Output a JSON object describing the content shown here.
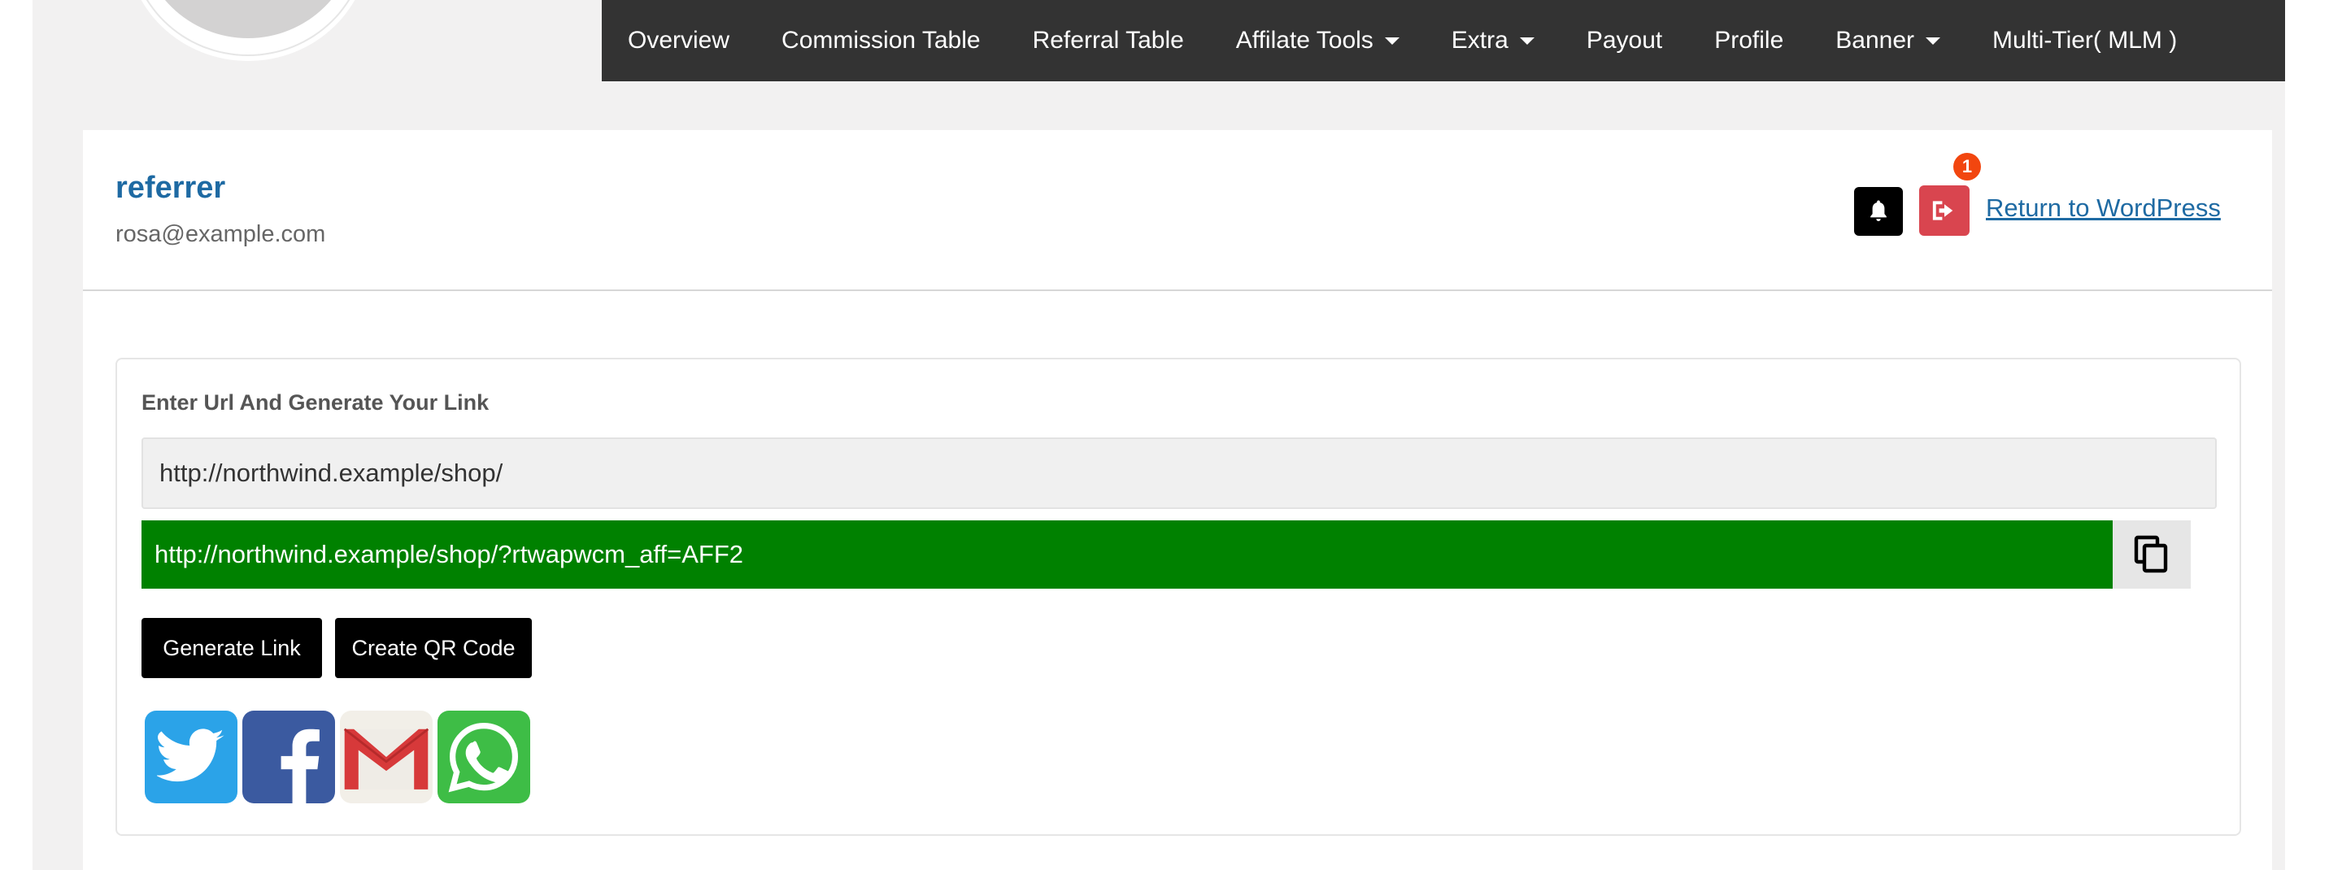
{
  "nav": {
    "items": [
      {
        "label": "Overview",
        "dropdown": false
      },
      {
        "label": "Commission Table",
        "dropdown": false
      },
      {
        "label": "Referral Table",
        "dropdown": false
      },
      {
        "label": "Affilate Tools",
        "dropdown": true
      },
      {
        "label": "Extra",
        "dropdown": true
      },
      {
        "label": "Payout",
        "dropdown": false
      },
      {
        "label": "Profile",
        "dropdown": false
      },
      {
        "label": "Banner",
        "dropdown": true
      },
      {
        "label": "Multi-Tier( MLM )",
        "dropdown": false
      }
    ]
  },
  "user": {
    "name": "referrer",
    "email": "rosa@example.com"
  },
  "header_actions": {
    "notification_count": "1",
    "return_label": "Return to WordPress"
  },
  "link_generator": {
    "label": "Enter Url And Generate Your Link",
    "url_value": "http://northwind.example/shop/",
    "generated_link": "http://northwind.example/shop/?rtwapwcm_aff=AFF2",
    "generate_button": "Generate Link",
    "qr_button": "Create QR Code"
  },
  "share": {
    "icons": [
      "twitter-icon",
      "facebook-icon",
      "gmail-icon",
      "whatsapp-icon"
    ]
  },
  "colors": {
    "nav_bg": "#333333",
    "link_blue": "#1e6aa3",
    "generated_bg": "#008100",
    "logout_red": "#d9454f",
    "badge_orange": "#f2460f"
  }
}
